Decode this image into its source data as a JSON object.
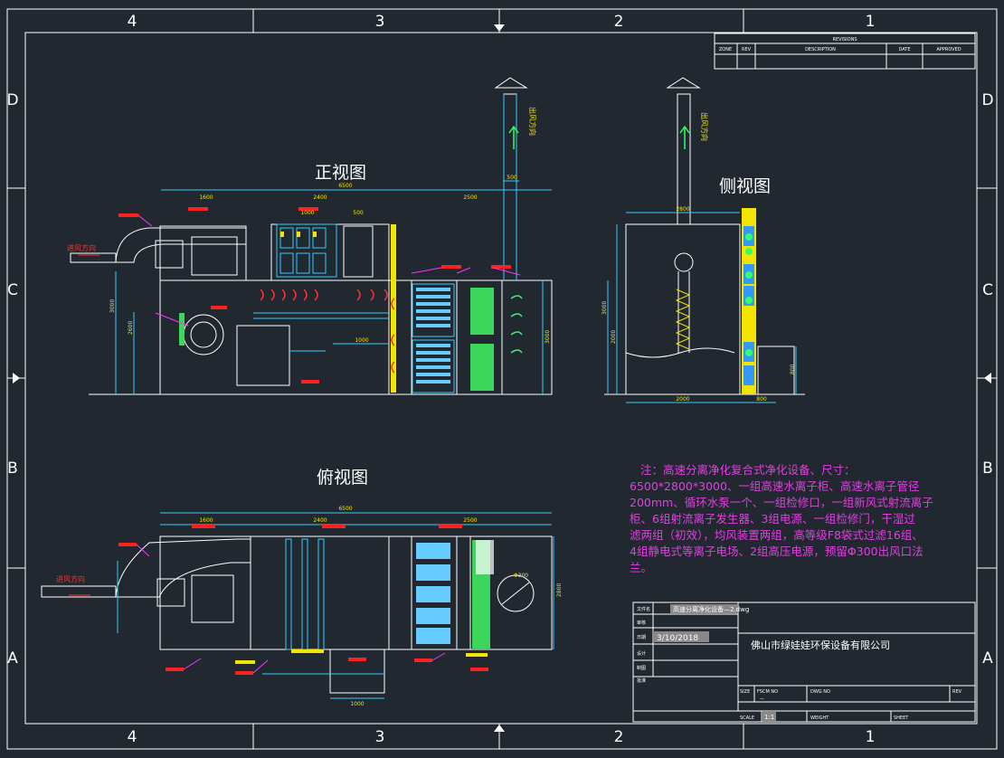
{
  "border": {
    "columns": [
      "4",
      "3",
      "2",
      "1"
    ],
    "rows": [
      "D",
      "C",
      "B",
      "A"
    ]
  },
  "revisions": {
    "title": "REVISIONS",
    "headers": [
      "ZONE",
      "REV",
      "DESCRIPTION",
      "DATE",
      "APPROVED"
    ]
  },
  "views": {
    "front": "正视图",
    "side": "侧视图",
    "top": "俯视图"
  },
  "flow_labels": {
    "inlet": "进风方向",
    "outlet": "出风方向"
  },
  "dimensions": {
    "front_overall": "6500",
    "front_left": "1600",
    "front_mid": "2400",
    "front_right": "2500",
    "front_box1": "1000",
    "front_box2": "500",
    "front_height": "3000",
    "front_sub": "2600",
    "side_width": "2800",
    "side_total": "3000",
    "side_bottom": "2000",
    "side_right": "800",
    "top_overall": "6500",
    "top_left": "1600",
    "top_mid": "2400",
    "top_right": "2500",
    "top_depth": "2800",
    "top_hatch": "1000",
    "circle": "Φ300"
  },
  "note": {
    "lines": [
      "注：高速分离净化复合式净化设备、尺寸：",
      "6500*2800*3000、一组高速水离子柜、高速水离子管径",
      "200mm、循环水泵一个、一组检修口，一组新风式射流离子",
      "柜、6组射流离子发生器、3组电源、一组检修门，干湿过",
      "滤两组（初效），均风装置两组，高等级F8袋式过滤16组、",
      "4组静电式等离子电场、2组高压电源，预留Φ300出风口法",
      "兰。"
    ]
  },
  "title_block": {
    "file_label": "文件名",
    "file_name": "高速分离净化设备—2.dwg",
    "date_label": "日期",
    "date": "3/10/2018",
    "row_labels": [
      "审核",
      "设计",
      "制图",
      "批准"
    ],
    "company": "佛山市绿娃娃环保设备有限公司",
    "size_label": "SIZE",
    "fscm_label": "FSCM NO",
    "fscm_value": "—",
    "dwg_label": "DWG NO",
    "rev_label": "REV",
    "scale_label": "SCALE",
    "scale": "1:1",
    "weight_label": "WEIGHT",
    "sheet_label": "SHEET"
  }
}
